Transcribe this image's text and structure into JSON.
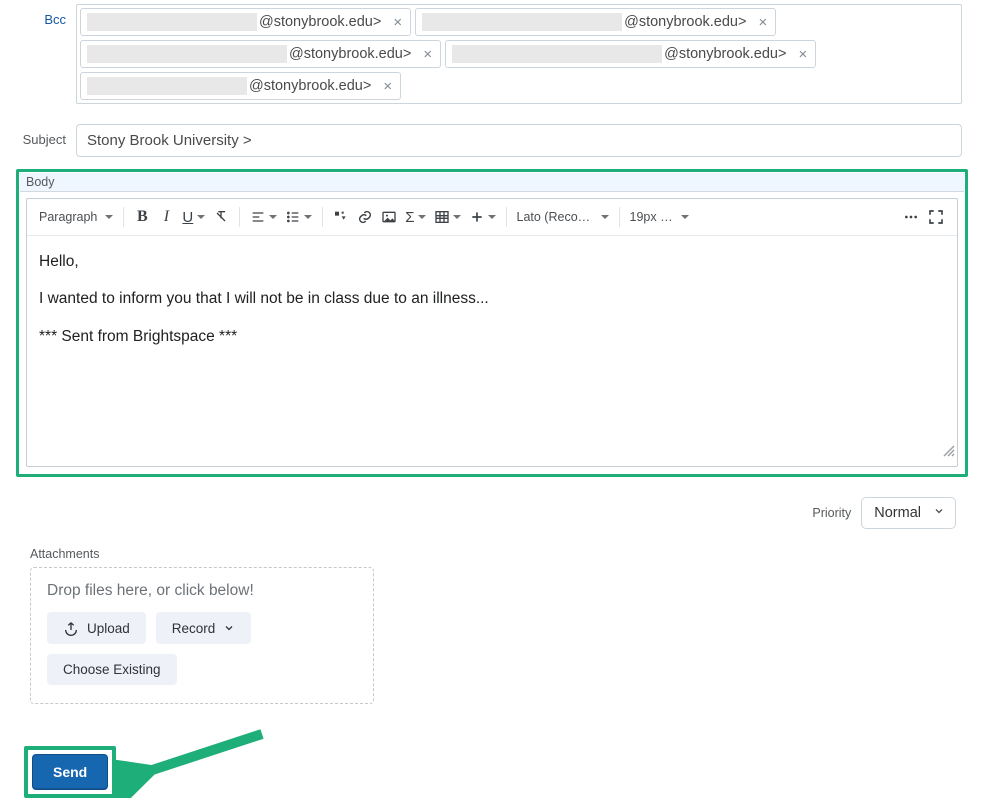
{
  "bcc": {
    "label": "Bcc",
    "chips": [
      {
        "suffix": "@stonybrook.edu>"
      },
      {
        "suffix": "@stonybrook.edu>"
      },
      {
        "suffix": "@stonybrook.edu>"
      },
      {
        "suffix": "@stonybrook.edu>"
      },
      {
        "suffix": "@stonybrook.edu>"
      }
    ]
  },
  "subject": {
    "label": "Subject",
    "value": "Stony Brook University >"
  },
  "body": {
    "label": "Body",
    "paragraphs": [
      "Hello,",
      "I wanted to inform you that I will not be in class due to an illness...",
      "",
      "*** Sent from Brightspace ***"
    ],
    "toolbar": {
      "paragraph": "Paragraph",
      "font": "Lato (Recom…",
      "size": "19px …"
    }
  },
  "priority": {
    "label": "Priority",
    "value": "Normal"
  },
  "attachments": {
    "label": "Attachments",
    "drop_text": "Drop files here, or click below!",
    "upload": "Upload",
    "record": "Record",
    "choose": "Choose Existing"
  },
  "send": {
    "label": "Send"
  }
}
